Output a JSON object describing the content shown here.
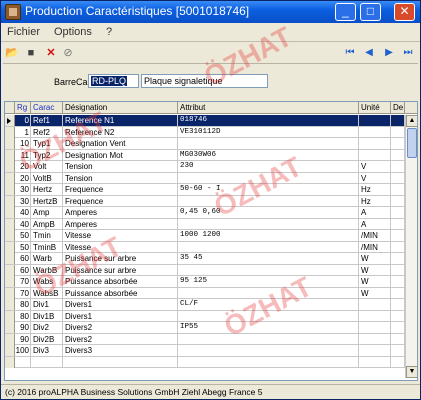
{
  "window": {
    "title": "Production Caractéristiques  [5001018746]",
    "minimize": "_",
    "maximize": "□",
    "close": "✕"
  },
  "menu": {
    "file": "Fichier",
    "options": "Options",
    "help": "?"
  },
  "toolbar": {
    "open_icon": "📂",
    "save_icon": "■",
    "delete_icon": "✕",
    "cancel_icon": "⊘",
    "first_icon": "⏮",
    "prev_icon": "◀",
    "next_icon": "▶",
    "last_icon": "⏭"
  },
  "filter": {
    "label": "BarreCar:",
    "code": "RD-PLQ",
    "description": "Plaque signaletique"
  },
  "grid": {
    "columns": [
      "Rg",
      "Carac",
      "Désignation",
      "Attribut",
      "Unité",
      "De"
    ],
    "rows": [
      {
        "rg": "0",
        "carac": "Ref1",
        "designation": "Reference N1",
        "attribut": "018746",
        "unite": ""
      },
      {
        "rg": "1",
        "carac": "Ref2",
        "designation": "Reference N2",
        "attribut": "VE310112D",
        "unite": ""
      },
      {
        "rg": "10",
        "carac": "Typ1",
        "designation": "Designation Vent",
        "attribut": "",
        "unite": ""
      },
      {
        "rg": "11",
        "carac": "Typ2",
        "designation": "Designation Mot",
        "attribut": "MG030W06",
        "unite": ""
      },
      {
        "rg": "20",
        "carac": "Volt",
        "designation": "Tension",
        "attribut": "230",
        "unite": "V"
      },
      {
        "rg": "20",
        "carac": "VoltB",
        "designation": "Tension",
        "attribut": "",
        "unite": "V"
      },
      {
        "rg": "30",
        "carac": "Hertz",
        "designation": "Frequence",
        "attribut": "50-60 - I",
        "unite": "Hz"
      },
      {
        "rg": "30",
        "carac": "HertzB",
        "designation": "Frequence",
        "attribut": "",
        "unite": "Hz"
      },
      {
        "rg": "40",
        "carac": "Amp",
        "designation": "Amperes",
        "attribut": "0,45 0,60",
        "unite": "A"
      },
      {
        "rg": "40",
        "carac": "AmpB",
        "designation": "Amperes",
        "attribut": "",
        "unite": "A"
      },
      {
        "rg": "50",
        "carac": "Tmin",
        "designation": "Vitesse",
        "attribut": "1000 1200",
        "unite": "/MIN"
      },
      {
        "rg": "50",
        "carac": "TminB",
        "designation": "Vitesse",
        "attribut": "",
        "unite": "/MIN"
      },
      {
        "rg": "60",
        "carac": "Warb",
        "designation": "Puissance sur arbre",
        "attribut": "35 45",
        "unite": "W"
      },
      {
        "rg": "60",
        "carac": "WarbB",
        "designation": "Puissance sur arbre",
        "attribut": "",
        "unite": "W"
      },
      {
        "rg": "70",
        "carac": "Wabs",
        "designation": "Puissance absorbée",
        "attribut": "95 125",
        "unite": "W"
      },
      {
        "rg": "70",
        "carac": "WabsB",
        "designation": "Puissance absorbée",
        "attribut": "",
        "unite": "W"
      },
      {
        "rg": "80",
        "carac": "Div1",
        "designation": "Divers1",
        "attribut": "CL/F",
        "unite": ""
      },
      {
        "rg": "80",
        "carac": "Div1B",
        "designation": "Divers1",
        "attribut": "",
        "unite": ""
      },
      {
        "rg": "90",
        "carac": "Div2",
        "designation": "Divers2",
        "attribut": "IP55",
        "unite": ""
      },
      {
        "rg": "90",
        "carac": "Div2B",
        "designation": "Divers2",
        "attribut": "",
        "unite": ""
      },
      {
        "rg": "100",
        "carac": "Div3",
        "designation": "Divers3",
        "attribut": "",
        "unite": ""
      },
      {
        "rg": "",
        "carac": "",
        "designation": "",
        "attribut": "",
        "unite": ""
      }
    ],
    "selected_row": 0,
    "scroll_up": "▲",
    "scroll_down": "▼"
  },
  "status": {
    "text": "(c) 2016 proALPHA Business Solutions GmbH  Ziehl Abegg France 5"
  },
  "watermark": "ÖZHAT"
}
